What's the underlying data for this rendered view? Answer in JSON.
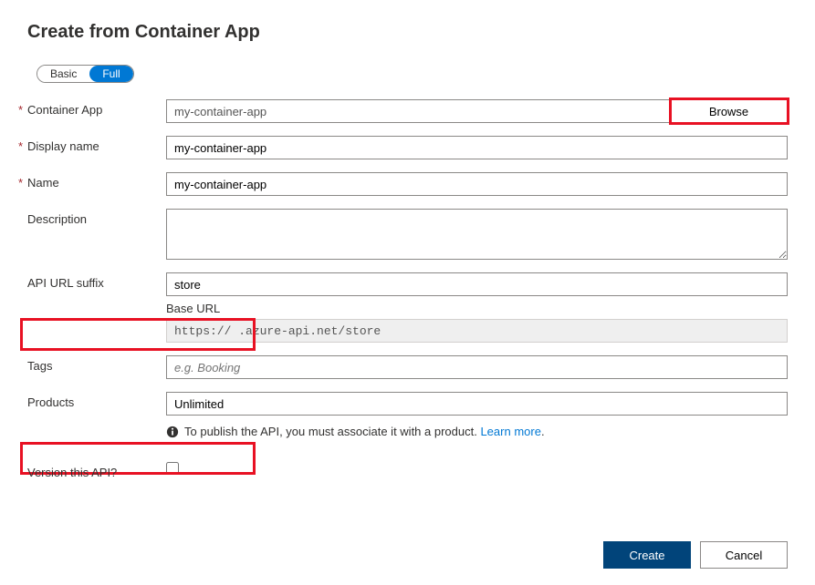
{
  "title": "Create from Container App",
  "mode": {
    "basic": "Basic",
    "full": "Full",
    "active": "full"
  },
  "labels": {
    "containerApp": "Container App",
    "displayName": "Display name",
    "name": "Name",
    "description": "Description",
    "apiUrlSuffix": "API URL suffix",
    "baseUrl": "Base URL",
    "tags": "Tags",
    "products": "Products",
    "versionThis": "Version this API?"
  },
  "values": {
    "containerApp": "my-container-app",
    "displayName": "my-container-app",
    "name": "my-container-app",
    "description": "",
    "apiUrlSuffix": "store",
    "baseUrl": "https://             .azure-api.net/store",
    "tags": "",
    "products": "Unlimited",
    "versionChecked": false
  },
  "placeholders": {
    "tags": "e.g. Booking"
  },
  "buttons": {
    "browse": "Browse",
    "create": "Create",
    "cancel": "Cancel"
  },
  "info": {
    "text": "To publish the API, you must associate it with a product. ",
    "link": "Learn more",
    "linkSuffix": "."
  }
}
